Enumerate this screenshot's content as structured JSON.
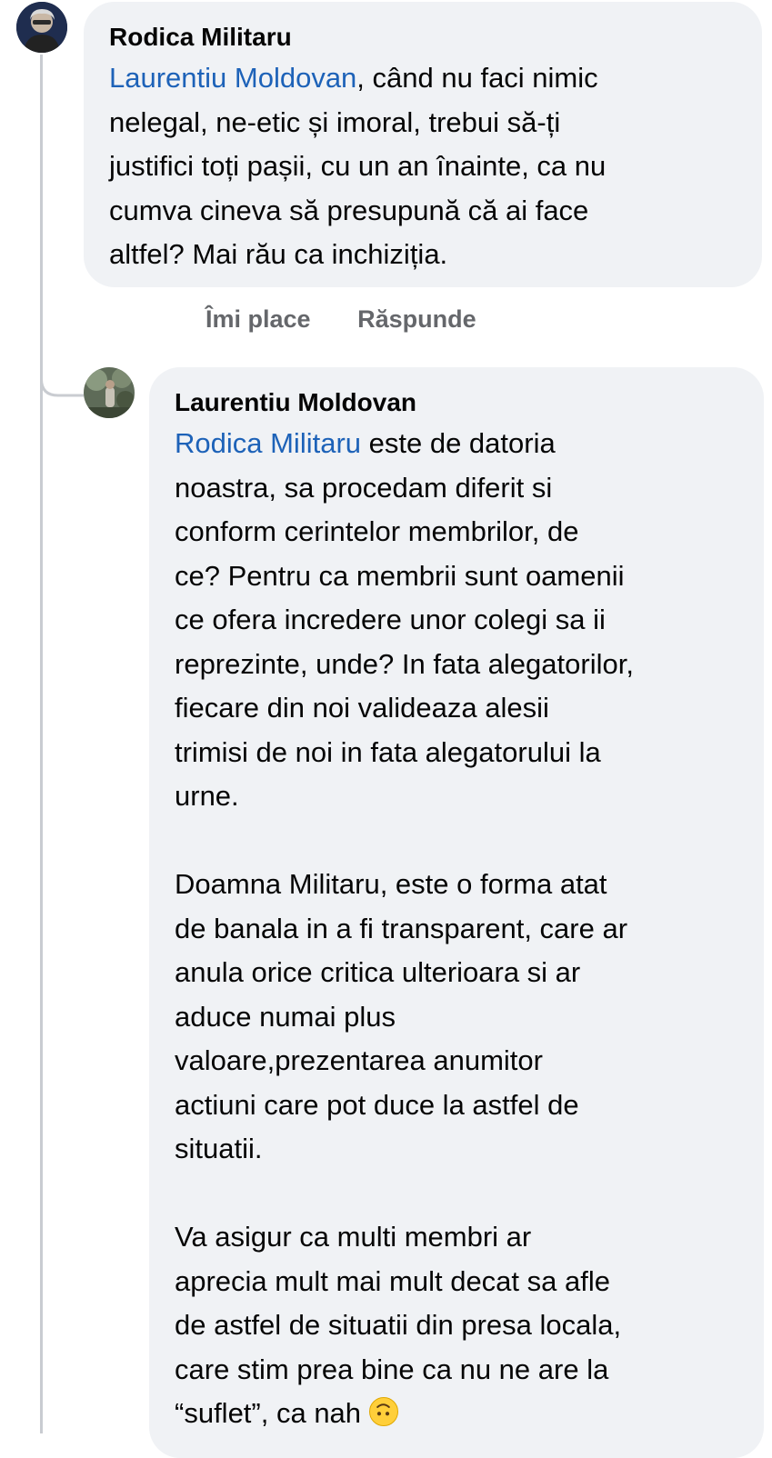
{
  "comments": [
    {
      "author": "Rodica Militaru",
      "mention": "Laurentiu Moldovan",
      "body": ", când nu faci nimic\nnelegal, ne-etic și imoral, trebui să-ți\njustifici toți pașii, cu un an înainte, ca nu\ncumva cineva să presupună că ai face\naltfel? Mai rău ca inchiziția."
    },
    {
      "author": "Laurentiu Moldovan",
      "mention": "Rodica Militaru",
      "body": " este de datoria\nnoastra, sa procedam diferit si\nconform cerintelor membrilor, de\nce? Pentru ca membrii sunt oamenii\nce ofera incredere unor colegi sa ii\nreprezinte, unde? In fata alegatorilor,\nfiecare din noi valideaza alesii\ntrimisi de noi in fata alegatorului la\nurne.\n\nDoamna Militaru, este o forma atat\nde banala in a fi transparent, care ar\nanula orice critica ulterioara si ar\naduce numai plus\nvaloare,prezentarea anumitor\nactiuni care pot duce la astfel de\nsituatii.\n\nVa asigur ca multi membri ar\naprecia mult mai mult decat sa afle\nde astfel de situatii din presa locala,\ncare stim prea bine ca nu ne are la\n“suflet”, ca nah "
    }
  ],
  "actions": {
    "like": "Îmi place",
    "reply": "Răspunde"
  },
  "icons": {
    "reply_emoji": "upside-down-face-emoji"
  }
}
